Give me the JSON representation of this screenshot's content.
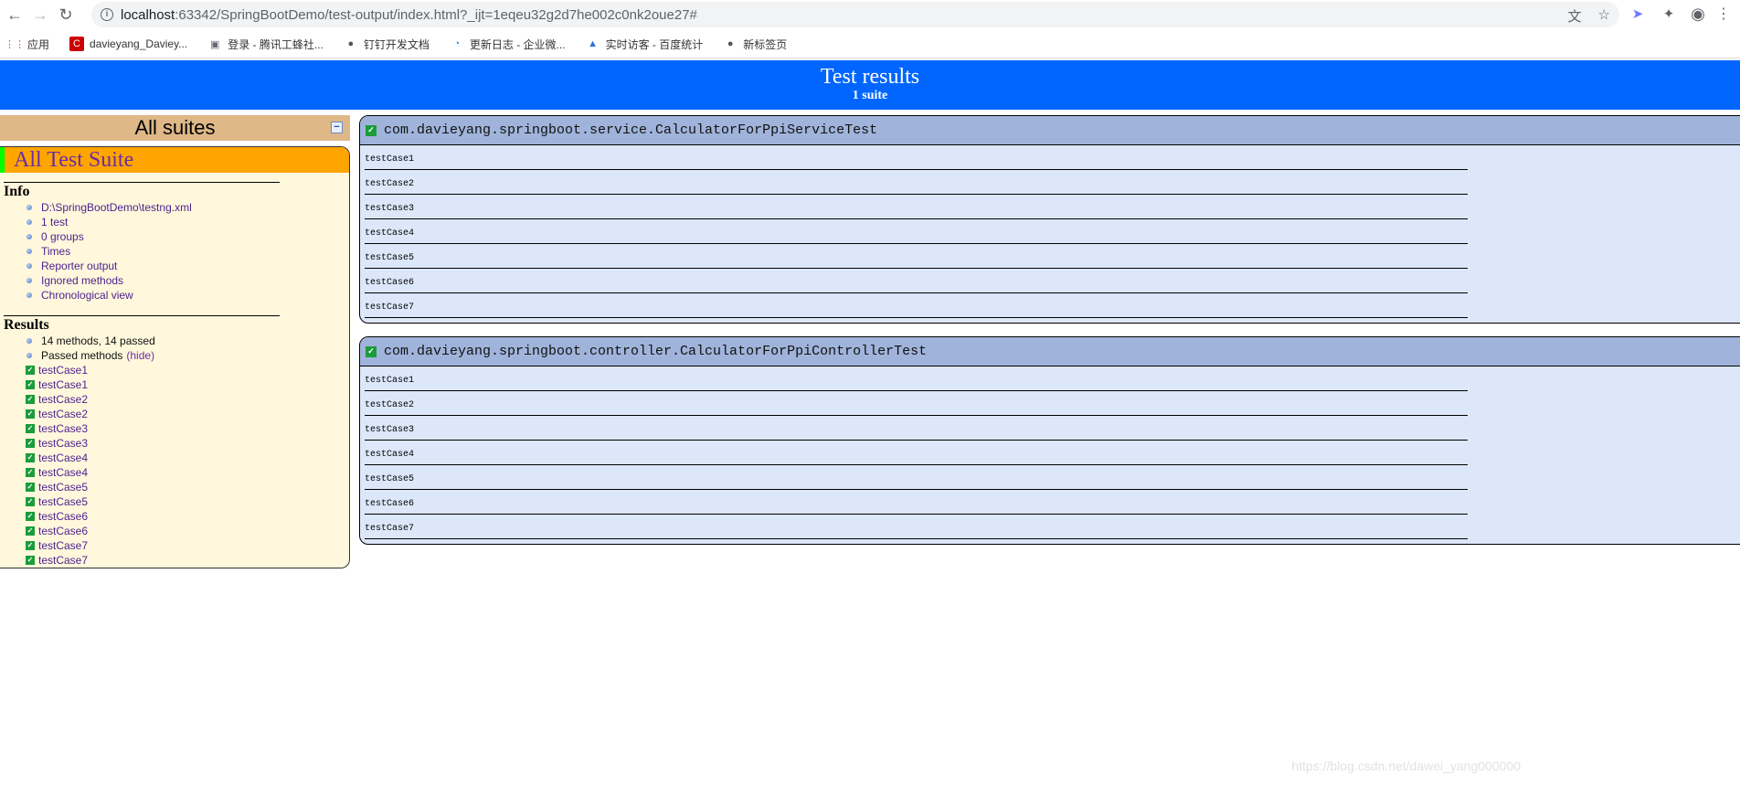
{
  "browser": {
    "url_host": "localhost",
    "url_rest": ":63342/SpringBootDemo/test-output/index.html?_ijt=1eqeu32g2d7he002c0nk2oue27#",
    "bookmarks": [
      {
        "icon": "apps-icon",
        "label": "应用"
      },
      {
        "icon": "csdn-icon",
        "label": "davieyang_Daviey..."
      },
      {
        "icon": "robot-icon",
        "label": "登录 - 腾讯工蜂社..."
      },
      {
        "icon": "globe-icon",
        "label": "钉钉开发文档"
      },
      {
        "icon": "qq-icon",
        "label": "更新日志 - 企业微..."
      },
      {
        "icon": "chart-icon",
        "label": "实时访客 - 百度统计"
      },
      {
        "icon": "globe-icon",
        "label": "新标签页"
      }
    ]
  },
  "banner": {
    "title": "Test results",
    "subtitle": "1 suite"
  },
  "sidebar": {
    "all_suites": "All suites",
    "suite_name": "All Test Suite",
    "info_heading": "Info",
    "info_items": [
      "D:\\SpringBootDemo\\testng.xml",
      "1 test",
      "0 groups",
      "Times",
      "Reporter output",
      "Ignored methods",
      "Chronological view"
    ],
    "results_heading": "Results",
    "summary": "14 methods, 14 passed",
    "passed_label": "Passed methods",
    "hide_label": "(hide)",
    "passed_methods": [
      "testCase1",
      "testCase1",
      "testCase2",
      "testCase2",
      "testCase3",
      "testCase3",
      "testCase4",
      "testCase4",
      "testCase5",
      "testCase5",
      "testCase6",
      "testCase6",
      "testCase7",
      "testCase7"
    ]
  },
  "panels": [
    {
      "class_name": "com.davieyang.springboot.service.CalculatorForPpiServiceTest",
      "methods": [
        "testCase1",
        "testCase2",
        "testCase3",
        "testCase4",
        "testCase5",
        "testCase6",
        "testCase7"
      ]
    },
    {
      "class_name": "com.davieyang.springboot.controller.CalculatorForPpiControllerTest",
      "methods": [
        "testCase1",
        "testCase2",
        "testCase3",
        "testCase4",
        "testCase5",
        "testCase6",
        "testCase7"
      ]
    }
  ],
  "watermark": "https://blog.csdn.net/dawei_yang000000",
  "colors": {
    "banner": "#0066ff",
    "all_suites": "#deb887",
    "suite_head": "#ffa500",
    "panel_head": "#a0b4db",
    "panel_body": "#dce7fa",
    "pass": "#1a9c3a"
  }
}
